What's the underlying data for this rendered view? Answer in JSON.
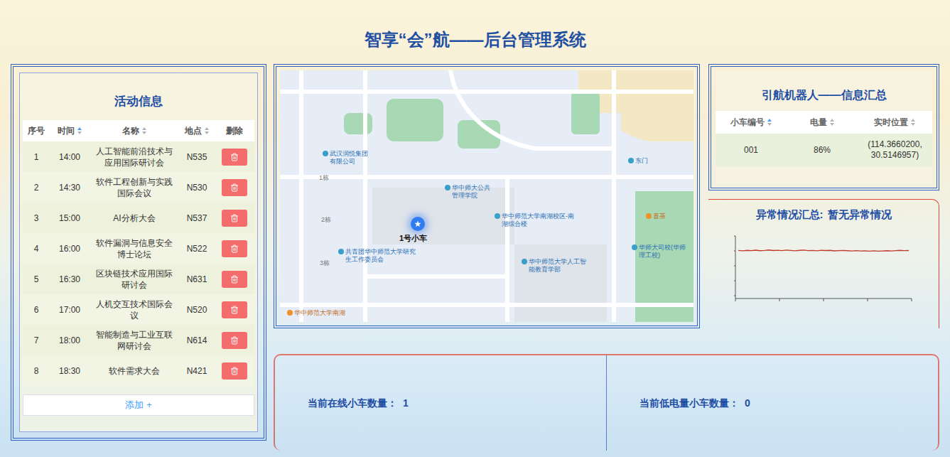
{
  "title": "智享“会”航——后台管理系统",
  "activity": {
    "title": "活动信息",
    "columns": [
      {
        "label": "序号",
        "sortable": false,
        "sorted": false
      },
      {
        "label": "时间",
        "sortable": true,
        "sorted": true
      },
      {
        "label": "名称",
        "sortable": true,
        "sorted": false
      },
      {
        "label": "地点",
        "sortable": true,
        "sorted": false
      },
      {
        "label": "删除",
        "sortable": false,
        "sorted": false
      }
    ],
    "rows": [
      {
        "index": "1",
        "time": "14:00",
        "name": "人工智能前沿技术与应用国际研讨会",
        "place": "N535"
      },
      {
        "index": "2",
        "time": "14:30",
        "name": "软件工程创新与实践国际会议",
        "place": "N530"
      },
      {
        "index": "3",
        "time": "15:00",
        "name": "AI分析大会",
        "place": "N537"
      },
      {
        "index": "4",
        "time": "16:00",
        "name": "软件漏洞与信息安全博士论坛",
        "place": "N522"
      },
      {
        "index": "5",
        "time": "16:30",
        "name": "区块链技术应用国际研讨会",
        "place": "N631"
      },
      {
        "index": "6",
        "time": "17:00",
        "name": "人机交互技术国际会议",
        "place": "N520"
      },
      {
        "index": "7",
        "time": "18:00",
        "name": "智能制造与工业互联网研讨会",
        "place": "N614"
      },
      {
        "index": "8",
        "time": "18:30",
        "name": "软件需求大会",
        "place": "N421"
      }
    ],
    "add_button": {
      "label": "添加",
      "icon": "+"
    }
  },
  "map": {
    "marker": {
      "label": "1号小车"
    },
    "labels": [
      {
        "text": "武汉润悦集团有限公司",
        "kind": "poi"
      },
      {
        "text": "1栋",
        "kind": "building"
      },
      {
        "text": "2栋",
        "kind": "building"
      },
      {
        "text": "3栋",
        "kind": "building"
      },
      {
        "text": "东门",
        "kind": "poi"
      },
      {
        "text": "华中师大公共管理学院",
        "kind": "poi"
      },
      {
        "text": "华中师范大学南湖校区-南湖综合楼",
        "kind": "poi"
      },
      {
        "text": "共青团华中师范大学研究生工作委员会",
        "kind": "poi"
      },
      {
        "text": "华中师范大学人工智能教育学部",
        "kind": "poi"
      },
      {
        "text": "喜茶",
        "kind": "shop"
      },
      {
        "text": "华师大司校(华师理工校)",
        "kind": "poi"
      },
      {
        "text": "华中师范大学南湖",
        "kind": "shop"
      }
    ]
  },
  "robots": {
    "title": "引航机器人——信息汇总",
    "columns": [
      {
        "label": "小车编号",
        "sorted": true
      },
      {
        "label": "电量",
        "sorted": false
      },
      {
        "label": "实时位置",
        "sorted": false
      }
    ],
    "rows": [
      {
        "id": "001",
        "battery": "86%",
        "position": "(114.3660200, 30.5146957)"
      }
    ]
  },
  "anomaly": {
    "label": "异常情况汇总:",
    "value": "暂无异常情况",
    "chart": {
      "values": [
        80,
        79.5,
        80.2,
        79.8,
        80.5,
        79.6,
        80.1,
        80.8,
        79.9,
        80.3,
        79.7,
        80.6,
        80.0,
        79.4,
        80.2,
        80.7,
        79.8,
        80.1,
        79.5,
        80.4,
        79.9,
        80.2,
        79.3,
        79.8,
        80.1,
        79.6,
        79.2,
        79.7,
        79.0,
        79.5,
        78.9,
        79.3,
        78.8,
        79.2,
        79.6,
        79.1,
        79.8,
        80.2,
        79.7,
        79.9
      ]
    }
  },
  "stats": [
    {
      "label": "当前在线小车数量：",
      "value": "1"
    },
    {
      "label": "当前低电量小车数量：",
      "value": "0"
    }
  ]
}
